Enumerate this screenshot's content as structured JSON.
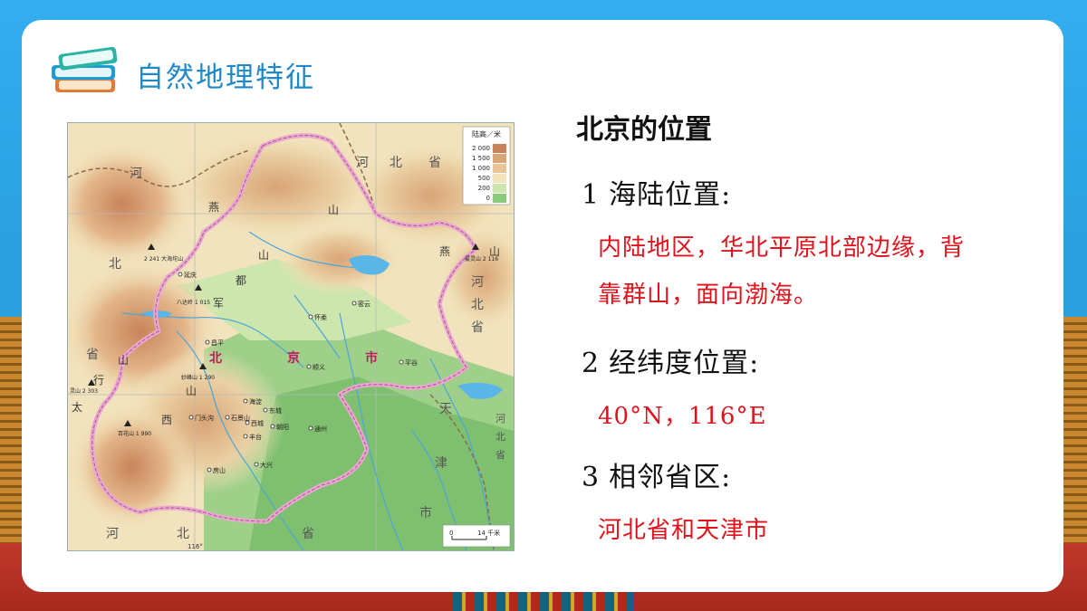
{
  "slide": {
    "title": "自然地理特征"
  },
  "map": {
    "legend_title": "陆高／米",
    "legend": [
      {
        "label": "2 000",
        "color": "#c9835a"
      },
      {
        "label": "1 500",
        "color": "#d9a476"
      },
      {
        "label": "1 000",
        "color": "#e9c596"
      },
      {
        "label": "500",
        "color": "#f4e4bd"
      },
      {
        "label": "200",
        "color": "#cde6ad"
      },
      {
        "label": "0",
        "color": "#8cc97d"
      }
    ],
    "scale_start": "0",
    "scale_end": "14 千米",
    "labels": {
      "hebei_top_1": "河",
      "hebei_top_2": "北",
      "hebei_top_3": "省",
      "hebei_right_1": "河",
      "hebei_right_2": "北",
      "hebei_right_3": "省",
      "hebei_left_1": "河",
      "hebei_left_2": "北",
      "hebei_left_3": "省",
      "hebei_bottom_1": "河",
      "hebei_bottom_2": "北",
      "hebei_bottom_3": "省",
      "beijing_1": "北",
      "beijing_2": "京",
      "beijing_3": "市",
      "tianjin_1": "天",
      "tianjin_2": "津",
      "tianjin_3": "市",
      "hebei_se_1": "河",
      "hebei_se_2": "北",
      "hebei_se_3": "省",
      "yanshan_1": "燕",
      "yanshan_2": "山",
      "yanshan_e_1": "燕",
      "yanshan_e_2": "山",
      "jundushan_1": "军",
      "jundushan_2": "都",
      "jundushan_3": "山",
      "taihang_1": "太",
      "taihang_2": "行",
      "taihang_3": "山",
      "xishan_1": "西",
      "xishan_2": "山",
      "city_yanqing": "延庆",
      "city_huairou": "怀柔",
      "city_miyun": "密云",
      "city_changping": "昌平",
      "city_shunyi": "顺义",
      "city_pinggu": "平谷",
      "city_haidian": "海淀",
      "city_dongcheng": "东城",
      "city_xicheng": "西城",
      "city_chaoyang": "朝阳",
      "city_shijingshan": "石景山",
      "city_fengtai": "丰台",
      "city_tongzhou": "通州",
      "city_mentougou": "门头沟",
      "city_fangshan": "房山",
      "city_daxing": "大兴",
      "peak_haituo": "2 241 大海坨山",
      "peak_badaling": "八达岭 1 015",
      "peak_lingshan": "灵山 2 303",
      "peak_miaofeng": "妙峰山 1 290",
      "peak_baicao": "百花山 1 990",
      "peak_wuling": "雾灵山 2 116",
      "lon_116": "116°"
    }
  },
  "content": {
    "heading": "北京的位置",
    "items": [
      {
        "num": "1",
        "title": "海陆位置:",
        "answer_line1": "内陆地区，华北平原北部边缘，背",
        "answer_line2": "靠群山，面向渤海。"
      },
      {
        "num": "2",
        "title": "经纬度位置:",
        "answer_line1": "40°N，116°E"
      },
      {
        "num": "3",
        "title": "相邻省区:",
        "answer_line1": "河北省和天津市"
      }
    ]
  }
}
